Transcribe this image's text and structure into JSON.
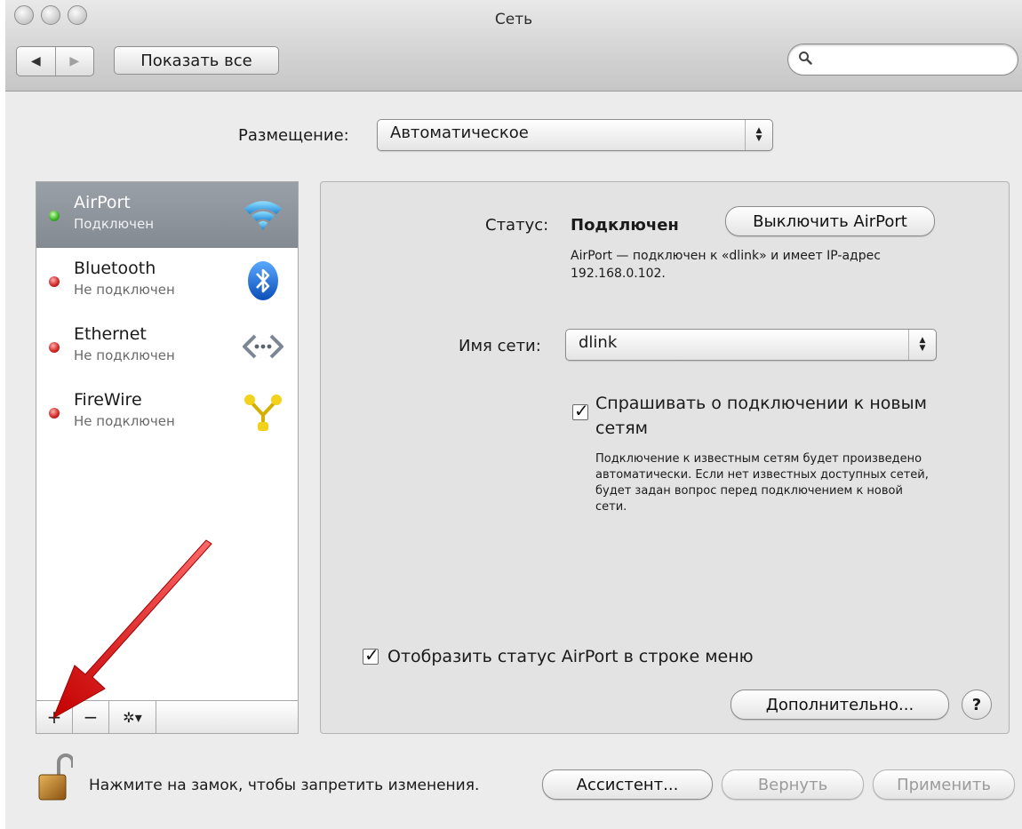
{
  "window": {
    "title": "Сеть"
  },
  "toolbar": {
    "back_icon": "◀",
    "forward_icon": "▶",
    "show_all_label": "Показать все",
    "search_placeholder": ""
  },
  "location": {
    "label": "Размещение:",
    "value": "Автоматическое"
  },
  "services": [
    {
      "name": "AirPort",
      "status": "Подключен",
      "state": "connected",
      "icon": "wifi-icon",
      "selected": true
    },
    {
      "name": "Bluetooth",
      "status": "Не подключен",
      "state": "disconnected",
      "icon": "bluetooth-icon",
      "selected": false
    },
    {
      "name": "Ethernet",
      "status": "Не подключен",
      "state": "disconnected",
      "icon": "ethernet-icon",
      "selected": false
    },
    {
      "name": "FireWire",
      "status": "Не подключен",
      "state": "disconnected",
      "icon": "firewire-icon",
      "selected": false
    }
  ],
  "list_toolbar": {
    "add": "+",
    "remove": "−",
    "action": "✲▾"
  },
  "detail": {
    "status_label": "Статус:",
    "status_value": "Подключен",
    "turn_off_label": "Выключить AirPort",
    "status_description": "AirPort — подключен к «dlink» и имеет IP-адрес 192.168.0.102.",
    "network_name_label": "Имя сети:",
    "network_name_value": "dlink",
    "ask_join_label": "Спрашивать о подключении к новым сетям",
    "ask_join_checked": true,
    "ask_join_description": "Подключение к известным сетям будет произведено автоматически. Если нет известных доступных сетей, будет задан вопрос перед подключением к новой сети.",
    "show_menu_status_label": "Отобразить статус AirPort в строке меню",
    "show_menu_status_checked": true,
    "advanced_label": "Дополнительно...",
    "help_label": "?"
  },
  "footer": {
    "lock_text": "Нажмите на замок, чтобы запретить изменения.",
    "assistant_label": "Ассистент...",
    "revert_label": "Вернуть",
    "apply_label": "Применить"
  },
  "colors": {
    "selection": "#8c929a",
    "connected": "#3fb62a",
    "disconnected": "#d22a2a",
    "annotation_arrow": "#e01010"
  }
}
